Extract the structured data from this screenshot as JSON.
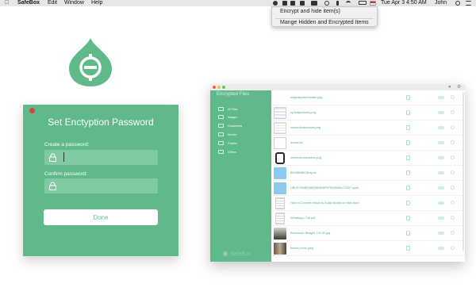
{
  "menubar": {
    "app_name": "SafeBox",
    "menus": [
      "Edit",
      "Window",
      "Help"
    ],
    "datetime": "Tue Apr 3  4:50 AM",
    "user": "John"
  },
  "dropdown": {
    "items": [
      "Encrypt and hide item(s)",
      "Mange Hidden and Encrypted Items"
    ]
  },
  "password_window": {
    "title": "Set Enctyption Password",
    "create_label": "Create a password:",
    "confirm_label": "Confirm password:",
    "done_label": "Done"
  },
  "files_window": {
    "sidebar_title": "Encrypted Files",
    "sidebar_items": [
      "All Files",
      "Images",
      "Documents",
      "Movies",
      "Folders",
      "Others"
    ],
    "brand": "SafeBox",
    "files": [
      "originalpicturefolder.png",
      "sy/hubpictures.png",
      "reasonfordemotes.png",
      "Isnote.txt",
      "screenshotsfolders.png",
      "BENIBBBK28.epub",
      "DBVD7EBB93BEB8B91BF97829B89A7C607.epub",
      "How to Convert eBook to Audio Books on Mac.docx",
      "WhatsApp Call.pdf",
      "Rushmore Bridges 2 ih 30.jpg",
      "beach.photo.jpeg"
    ]
  },
  "colors": {
    "brand_green": "#5fb989",
    "field_green": "#7fcaa1",
    "close_red": "#d8453a"
  }
}
